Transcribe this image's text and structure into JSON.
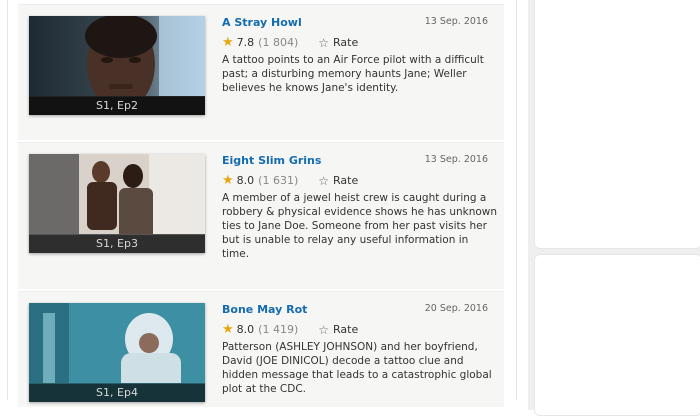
{
  "episodes": [
    {
      "title": "A Stray Howl",
      "date": "13 Sep. 2016",
      "rating": "7.8",
      "votes": "(1 804)",
      "rate_label": "Rate",
      "description": "A tattoo points to an Air Force pilot with a difficult past; a disturbing memory haunts Jane; Weller believes he knows Jane's identity.",
      "caption": "S1, Ep2"
    },
    {
      "title": "Eight Slim Grins",
      "date": "13 Sep. 2016",
      "rating": "8.0",
      "votes": "(1 631)",
      "rate_label": "Rate",
      "description": "A member of a jewel heist crew is caught during a robbery & physical evidence shows he has unknown ties to Jane Doe. Someone from her past visits her but is unable to relay any useful information in time.",
      "caption": "S1, Ep3"
    },
    {
      "title": "Bone May Rot",
      "date": "20 Sep. 2016",
      "rating": "8.0",
      "votes": "(1 419)",
      "rate_label": "Rate",
      "description": "Patterson (ASHLEY JOHNSON) and her boyfriend, David (JOE DINICOL) decode a tattoo clue and hidden message that leads to a catastrophic global plot at the CDC.",
      "caption": "S1, Ep4"
    }
  ],
  "icons": {
    "rating_star": "star-filled-icon",
    "rate_star": "star-outline-icon"
  },
  "colors": {
    "title_link": "#136cb2",
    "rating_star": "#e8a60c",
    "card_background": "#f6f6f5"
  }
}
